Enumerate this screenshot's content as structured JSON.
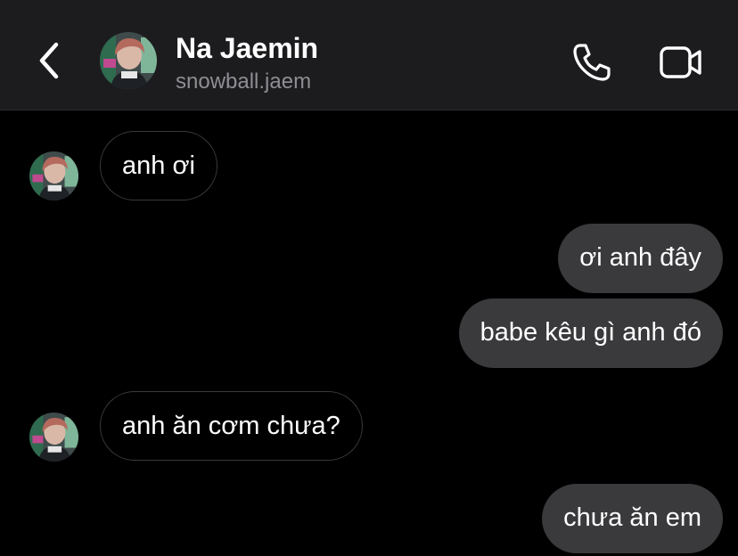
{
  "header": {
    "contact_name": "Na Jaemin",
    "contact_handle": "snowball.jaem",
    "icons": {
      "back": "chevron-left-icon",
      "call": "phone-icon",
      "video": "video-camera-icon"
    }
  },
  "messages": [
    {
      "direction": "incoming",
      "text": "anh ơi"
    },
    {
      "direction": "outgoing",
      "text": "ơi anh đây"
    },
    {
      "direction": "outgoing",
      "text": "babe kêu gì anh đó"
    },
    {
      "direction": "incoming",
      "text": "anh ăn cơm chưa?"
    },
    {
      "direction": "outgoing",
      "text": "chưa ăn em"
    }
  ],
  "colors": {
    "background": "#000000",
    "header_background": "#1c1c1e",
    "outgoing_bubble": "#3a3a3c",
    "incoming_bubble_border": "#3a3a3c",
    "secondary_text": "#8e8e93"
  }
}
